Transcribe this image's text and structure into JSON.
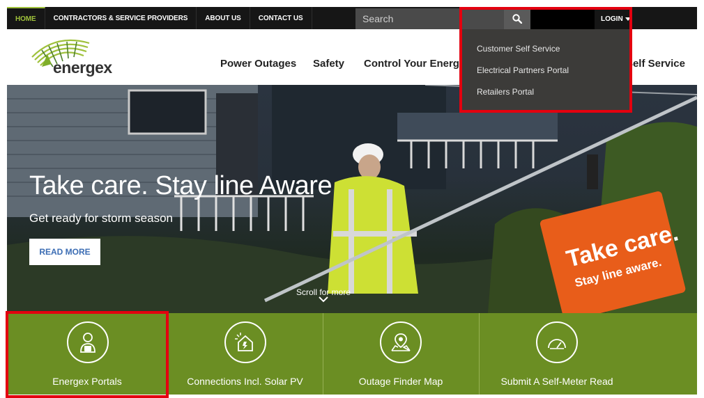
{
  "topnav": {
    "items": [
      {
        "label": "HOME",
        "active": true
      },
      {
        "label": "CONTRACTORS & SERVICE PROVIDERS"
      },
      {
        "label": "ABOUT US"
      },
      {
        "label": "CONTACT US"
      }
    ]
  },
  "search": {
    "placeholder": "Search"
  },
  "login": {
    "label": "LOGIN"
  },
  "login_menu": {
    "items": [
      "Customer Self Service",
      "Electrical Partners Portal",
      "Retailers Portal"
    ]
  },
  "brand": {
    "name": "energex",
    "accent": "#9fc13b"
  },
  "mainnav": {
    "items": [
      "Power Outages",
      "Safety",
      "Control Your Energy",
      "Self Service"
    ]
  },
  "hero": {
    "title": "Take care. Stay line Aware",
    "subtitle": "Get ready for storm season",
    "cta": "READ MORE",
    "scroll": "Scroll for more",
    "sign_line1": "Take care.",
    "sign_line2": "Stay line aware."
  },
  "tiles": [
    {
      "label": "Energex Portals",
      "icon": "user-lock-icon"
    },
    {
      "label": "Connections Incl. Solar PV",
      "icon": "solar-house-icon"
    },
    {
      "label": "Outage Finder Map",
      "icon": "map-pin-icon"
    },
    {
      "label": "Submit A Self-Meter Read",
      "icon": "meter-gauge-icon"
    }
  ],
  "colors": {
    "tile_green": "#6b8e23",
    "highlight_red": "#e3000f",
    "topbar": "#161616"
  }
}
